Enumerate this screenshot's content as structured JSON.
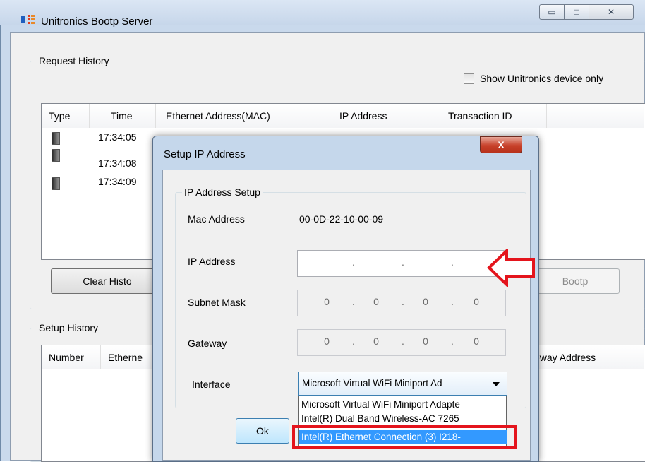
{
  "window": {
    "title": "Unitronics Bootp Server",
    "controls": {
      "minimize": "▭",
      "maximize": "□",
      "close": "✕"
    }
  },
  "request_history": {
    "legend": "Request History",
    "show_unitronics_only_label": "Show Unitronics device only",
    "columns": [
      "Type",
      "Time",
      "Ethernet Address(MAC)",
      "IP Address",
      "Transaction ID"
    ],
    "rows": [
      {
        "time": "17:34:05"
      },
      {
        "time": "17:34:08"
      },
      {
        "time": "17:34:09"
      }
    ],
    "clear_button": "Clear Histo",
    "bootp_button": "Bootp"
  },
  "setup_history": {
    "legend": "Setup History",
    "columns": [
      "Number",
      "Etherne",
      "eway Address"
    ]
  },
  "dialog": {
    "title": "Setup IP Address",
    "close": "X",
    "group_legend": "IP Address Setup",
    "mac_label": "Mac Address",
    "mac_value": "00-0D-22-10-00-09",
    "ip_label": "IP Address",
    "subnet_label": "Subnet Mask",
    "subnet_octets": [
      "0",
      "0",
      "0",
      "0"
    ],
    "gateway_label": "Gateway",
    "gateway_octets": [
      "0",
      "0",
      "0",
      "0"
    ],
    "interface_label": "Interface",
    "interface_selected": "Microsoft Virtual WiFi Miniport Ad",
    "interface_options": [
      "Microsoft Virtual WiFi Miniport Adapte",
      "Intel(R) Dual Band Wireless-AC 7265",
      "Intel(R) Ethernet Connection (3) I218-"
    ],
    "ok_button": "Ok"
  },
  "colors": {
    "annotation_red": "#e4141c",
    "selection_blue": "#3399ff"
  }
}
